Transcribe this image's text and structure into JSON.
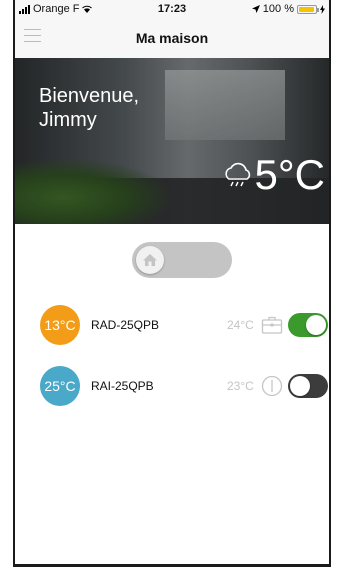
{
  "status_bar": {
    "carrier": "Orange F",
    "time": "17:23",
    "battery": "100 %",
    "battery_level": 1.0
  },
  "nav": {
    "title": "Ma maison",
    "menu_icon": "hamburger-menu-icon"
  },
  "hero": {
    "welcome_line1": "Bienvenue,",
    "welcome_line2": "Jimmy",
    "weather_icon": "cloud-rain-icon",
    "outside_temp": "5°C"
  },
  "mode_switch": {
    "icon": "home-icon",
    "state": "off"
  },
  "devices": [
    {
      "current_temp": "13°C",
      "name": "RAD-25QPB",
      "set_temp": "24°C",
      "mode_icon": "briefcase-icon",
      "on": true,
      "badge_color": "#f39c17"
    },
    {
      "current_temp": "25°C",
      "name": "RAI-25QPB",
      "set_temp": "23°C",
      "mode_icon": "power-icon",
      "on": false,
      "badge_color": "#4aa8c9"
    }
  ],
  "colors": {
    "toggle_on": "#3a9a2c",
    "toggle_off": "#3c3c3c",
    "battery": "#f5c400"
  }
}
